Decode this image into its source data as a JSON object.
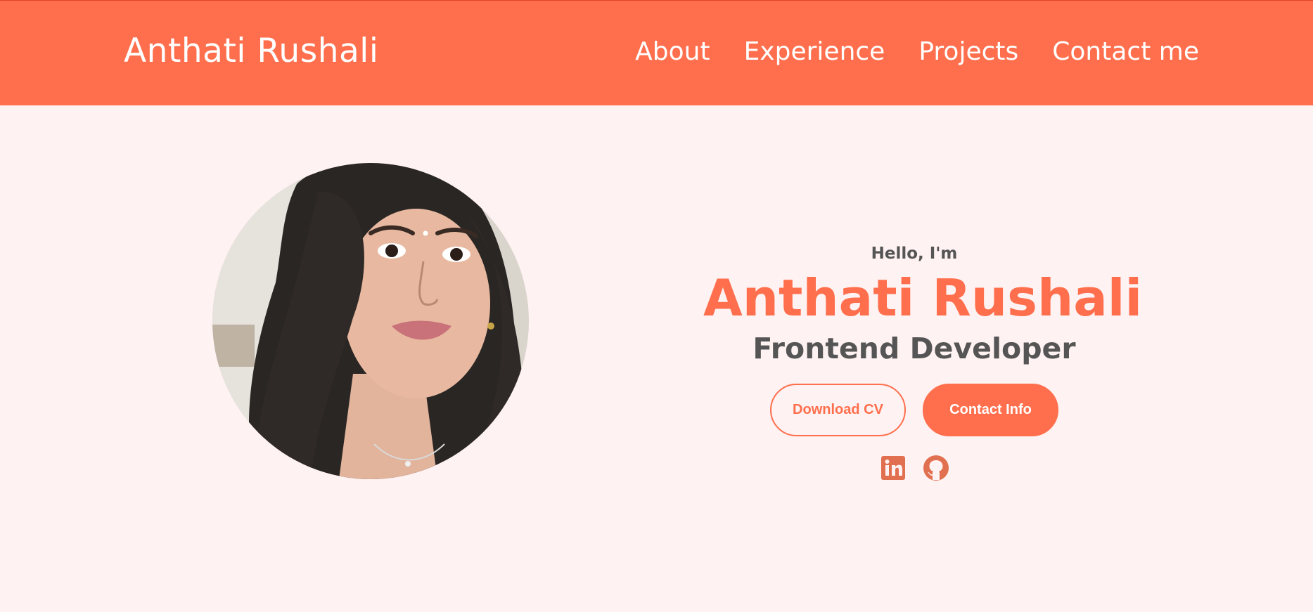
{
  "nav": {
    "logo": "Anthati Rushali",
    "links": [
      "About",
      "Experience",
      "Projects",
      "Contact me"
    ]
  },
  "profile": {
    "image": "profile-photo"
  },
  "intro": {
    "greeting": "Hello, I'm",
    "name": "Anthati Rushali",
    "role": "Frontend Developer"
  },
  "buttons": {
    "download_cv": "Download CV",
    "contact_info": "Contact Info"
  },
  "socials": {
    "icons": [
      "linkedin-icon",
      "github-icon"
    ]
  },
  "colors": {
    "accent": "#ff6f4d",
    "background": "#fff2f2",
    "text": "#555555"
  }
}
